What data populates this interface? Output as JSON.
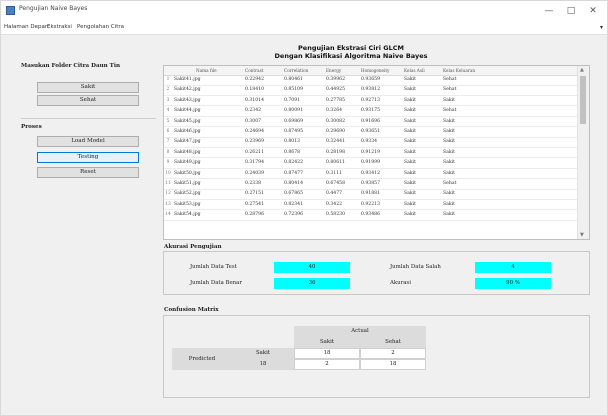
{
  "window": {
    "title": "Pengujian Naive Bayes",
    "controls": {
      "minimize": "—",
      "maximize": "□",
      "close": "✕"
    }
  },
  "menu": {
    "items": [
      "Halaman Depan",
      "Ekstraksi",
      "Pengolahan Citra"
    ]
  },
  "left": {
    "folder_title": "Masukan Folder Citra Daun Tin",
    "sakit_button": "Sakit",
    "sehat_button": "Sehat",
    "proses_title": "Proses",
    "load_model_button": "Load Model",
    "testing_button": "Testing",
    "reset_button": "Reset"
  },
  "header": {
    "line1": "Pengujian Ekstrasi Ciri GLCM",
    "line2": "Dengan Klasifikasi Algoritma Naive Bayes"
  },
  "table": {
    "columns": [
      "Nama file",
      "Contrast",
      "Correlation",
      "Energy",
      "Homogeneity",
      "Kelas Asli",
      "Kelas Keluaran"
    ],
    "rows": [
      {
        "no": "1",
        "file": "Sakit41.jpg",
        "contrast": "0.22942",
        "correlation": "0.80461",
        "energy": "0.39962",
        "homogeneity": "0.93659",
        "asli": "Sakit",
        "keluaran": "Sehat"
      },
      {
        "no": "2",
        "file": "Sakit42.jpg",
        "contrast": "0.18410",
        "correlation": "0.85109",
        "energy": "0.44925",
        "homogeneity": "0.93812",
        "asli": "Sakit",
        "keluaran": "Sehat"
      },
      {
        "no": "3",
        "file": "Sakit43.jpg",
        "contrast": "0.31014",
        "correlation": "0.7091",
        "energy": "0.27785",
        "homogeneity": "0.92713",
        "asli": "Sakit",
        "keluaran": "Sakit"
      },
      {
        "no": "4",
        "file": "Sakit44.jpg",
        "contrast": "0.2342",
        "correlation": "0.80091",
        "energy": "0.3264",
        "homogeneity": "0.93175",
        "asli": "Sakit",
        "keluaran": "Sehat"
      },
      {
        "no": "5",
        "file": "Sakit45.jpg",
        "contrast": "0.3007",
        "correlation": "0.69869",
        "energy": "0.30082",
        "homogeneity": "0.91696",
        "asli": "Sakit",
        "keluaran": "Sakit"
      },
      {
        "no": "6",
        "file": "Sakit46.jpg",
        "contrast": "0.24694",
        "correlation": "0.87495",
        "energy": "0.29690",
        "homogeneity": "0.93651",
        "asli": "Sakit",
        "keluaran": "Sakit"
      },
      {
        "no": "7",
        "file": "Sakit47.jpg",
        "contrast": "0.23969",
        "correlation": "0.8013",
        "energy": "0.32441",
        "homogeneity": "0.9334",
        "asli": "Sakit",
        "keluaran": "Sakit"
      },
      {
        "no": "8",
        "file": "Sakit48.jpg",
        "contrast": "0.26211",
        "correlation": "0.8678",
        "energy": "0.28198",
        "homogeneity": "0.91219",
        "asli": "Sakit",
        "keluaran": "Sakit"
      },
      {
        "no": "9",
        "file": "Sakit49.jpg",
        "contrast": "0.31794",
        "correlation": "0.82422",
        "energy": "0.80611",
        "homogeneity": "0.91999",
        "asli": "Sakit",
        "keluaran": "Sakit"
      },
      {
        "no": "10",
        "file": "Sakit50.jpg",
        "contrast": "0.24039",
        "correlation": "0.87477",
        "energy": "0.3111",
        "homogeneity": "0.93412",
        "asli": "Sakit",
        "keluaran": "Sakit"
      },
      {
        "no": "11",
        "file": "Sakit51.jpg",
        "contrast": "0.2338",
        "correlation": "0.80414",
        "energy": "0.67458",
        "homogeneity": "0.93857",
        "asli": "Sakit",
        "keluaran": "Sehat"
      },
      {
        "no": "12",
        "file": "Sakit52.jpg",
        "contrast": "0.27151",
        "correlation": "0.67865",
        "energy": "0.4477",
        "homogeneity": "0.91881",
        "asli": "Sakit",
        "keluaran": "Sakit"
      },
      {
        "no": "13",
        "file": "Sakit53.jpg",
        "contrast": "0.27541",
        "correlation": "0.82341",
        "energy": "0.3422",
        "homogeneity": "0.92213",
        "asli": "Sakit",
        "keluaran": "Sakit"
      },
      {
        "no": "14",
        "file": "Sakit54.jpg",
        "contrast": "0.28796",
        "correlation": "0.72396",
        "energy": "0.58230",
        "homogeneity": "0.93486",
        "asli": "Sakit",
        "keluaran": "Sakit"
      }
    ]
  },
  "akurasi": {
    "title": "Akurasi Pengujian",
    "total_label": "Jumlah Data Test",
    "total_value": "40",
    "benar_label": "Jumlah Data Benar",
    "benar_value": "36",
    "salah_label": "Jumlah Data Salah",
    "salah_value": "4",
    "akurasi_label": "Akurasi",
    "akurasi_value": "90 %"
  },
  "confusion": {
    "title": "Confusion Matrix",
    "actual_label": "Actual",
    "predicted_label": "Predicted",
    "col_sakit": "Sakit",
    "col_sehat": "Sehat",
    "row_sakit": "Sakit",
    "row_sehat": "18",
    "v11": "18",
    "v12": "2",
    "v21": "2",
    "v22": "18"
  },
  "colors": {
    "accent": "#00ffff",
    "selected_border": "#0078d7"
  }
}
